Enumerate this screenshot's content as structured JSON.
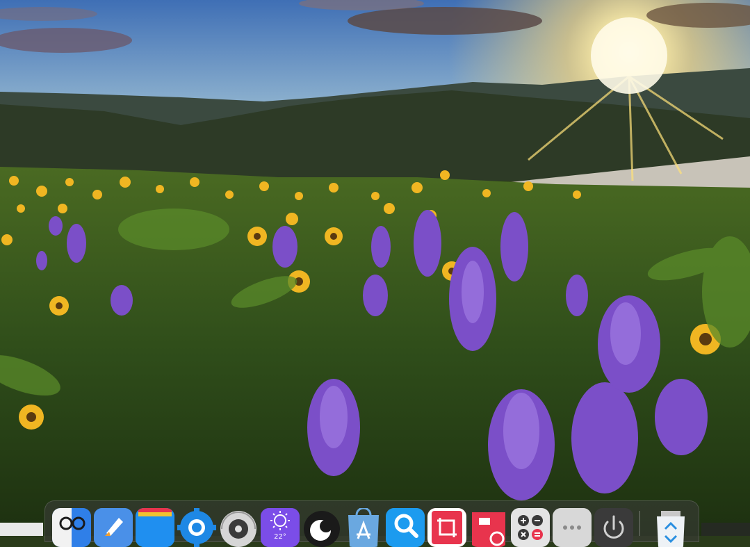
{
  "desktop": {
    "wallpaper": "mountain-meadow-sunset",
    "accent": "#f2c230"
  },
  "dock": {
    "items": [
      {
        "name": "finder-icon",
        "color": "#2f7fe8"
      },
      {
        "name": "launchpad-icon",
        "color": "#3a8ef0"
      },
      {
        "name": "files-icon",
        "color": "#1f8ff0"
      },
      {
        "name": "settings-gear-icon",
        "color": "#1e88e5"
      },
      {
        "name": "disk-utility-icon",
        "color": "#d0d0d0"
      },
      {
        "name": "weather-icon",
        "color": "#7b4de8",
        "label": "22°"
      },
      {
        "name": "theme-icon",
        "color": "#1a1a1a"
      },
      {
        "name": "app-store-icon",
        "color": "#4aa3e8"
      },
      {
        "name": "search-icon",
        "color": "#1c9bef"
      },
      {
        "name": "screenshot-icon",
        "color": "#e8344d"
      },
      {
        "name": "mindmap-icon",
        "color": "#e8344d"
      },
      {
        "name": "calculator-icon",
        "color": "#dcdcdc"
      },
      {
        "name": "more-icon",
        "color": "#d8d8d8"
      },
      {
        "name": "power-icon",
        "color": "#3a3a3a"
      },
      {
        "name": "recycle-bin-icon",
        "color": "#e8eef5"
      }
    ]
  }
}
